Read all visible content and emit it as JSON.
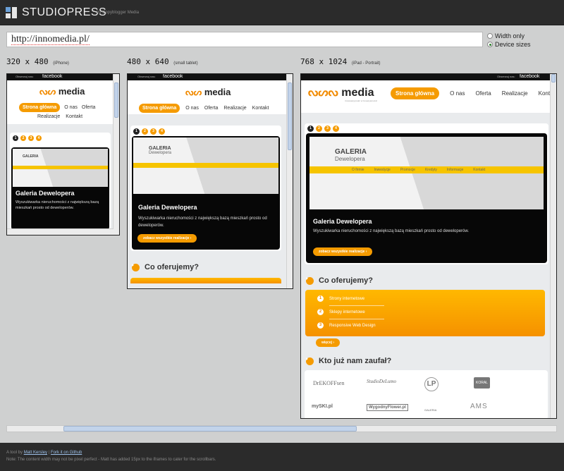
{
  "header": {
    "brand": "STUDIOPRESS",
    "tagline": "by Copyblogger Media"
  },
  "url_input": {
    "value": "http://innomedia.pl/"
  },
  "options": {
    "width_only": "Width only",
    "device_sizes": "Device sizes",
    "selected": "device_sizes"
  },
  "devices": [
    {
      "size": "320 x 480",
      "name": "(iPhone)"
    },
    {
      "size": "480 x 640",
      "name": "(small tablet)"
    },
    {
      "size": "768 x 1024",
      "name": "(iPad - Portrait)"
    }
  ],
  "site": {
    "social_prefix": "Obserwuj nas:",
    "social_link": "facebook",
    "logo_text": "media",
    "logo_tagline": "innowacyjność w kreatywności",
    "nav": [
      "Strona główna",
      "O nas",
      "Oferta",
      "Realizacje",
      "Kontakt"
    ],
    "slider_dots": [
      "1",
      "2",
      "3",
      "4"
    ],
    "screenshot": {
      "title": "GALERIA",
      "subtitle": "Dewelopera",
      "menu": [
        "O firmie",
        "Inwestycje",
        "Promocje",
        "Kredyty",
        "Informacje",
        "Kontakt"
      ]
    },
    "gallery_title": "Galeria Dewelopera",
    "gallery_desc": "Wyszukiwarka nieruchomości z największą bazą mieszkań prosto od deweloperów.",
    "gallery_button": "zobacz wszystkie realizacje",
    "offer_title": "Co oferujemy?",
    "offer_items": [
      {
        "num": "1",
        "label": "Strony internetowe"
      },
      {
        "num": "2",
        "label": "Sklepy internetowe"
      },
      {
        "num": "3",
        "label": "Responsive Web Design"
      }
    ],
    "offer_button": "więcej",
    "clients_title": "Kto już nam zaufał?",
    "clients": [
      "DrEKOFFsen",
      "StudioDeLumo",
      "LP",
      "KORAL",
      "mySKI.pl",
      "WygodnyFlower.pl",
      "GALERIA",
      "AMS"
    ]
  },
  "footer": {
    "line1_prefix": "A tool by",
    "author": "Matt Kersley",
    "separator": "|",
    "fork": "Fork it on Github",
    "note": "Note: The content width may not be pixel perfect - Matt has added 15px to the iframes to cater for the scrollbars."
  },
  "colors": {
    "accent": "#f59b00",
    "dark": "#2b2b2b",
    "link": "#9dc0e8"
  }
}
